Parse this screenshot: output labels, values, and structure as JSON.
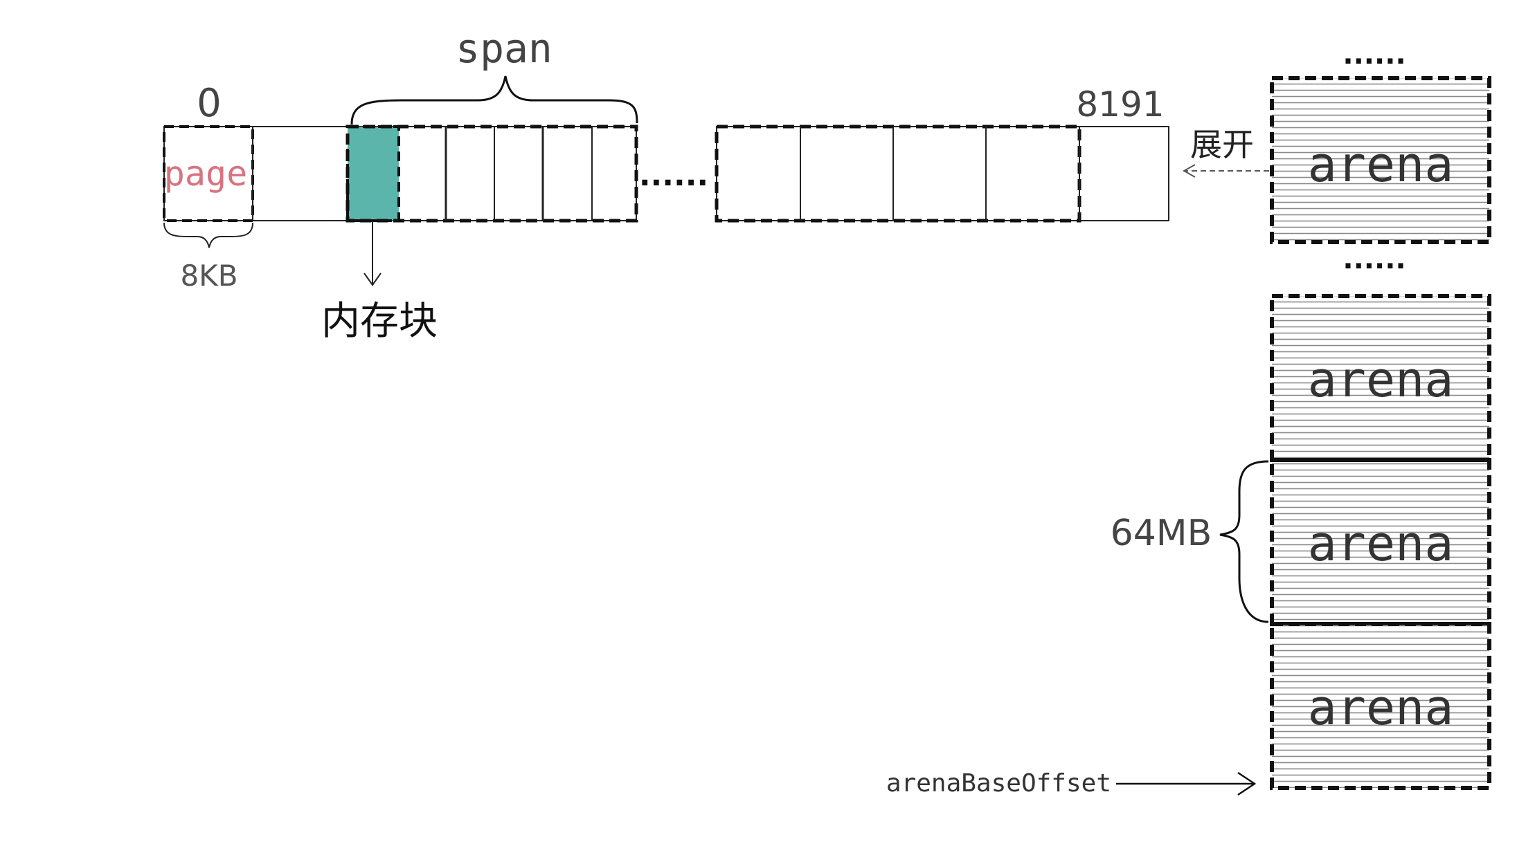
{
  "labels": {
    "span": "span",
    "start_index": "0",
    "end_index": "8191",
    "page": "page",
    "page_size": "8KB",
    "memory_block": "内存块",
    "expand": "展开",
    "ellipsis_row": "......",
    "ellipsis_top": "......",
    "ellipsis_mid": "......",
    "arena_size": "64MB",
    "arena_base_offset": "arenaBaseOffset"
  },
  "arenas": [
    {
      "label": "arena"
    },
    {
      "label": "arena"
    },
    {
      "label": "arena"
    },
    {
      "label": "arena"
    }
  ],
  "colors": {
    "highlight_block": "#3fa89b",
    "page_label": "#d9727f",
    "line": "#222222",
    "text": "#444444",
    "hatch": "#777777"
  }
}
